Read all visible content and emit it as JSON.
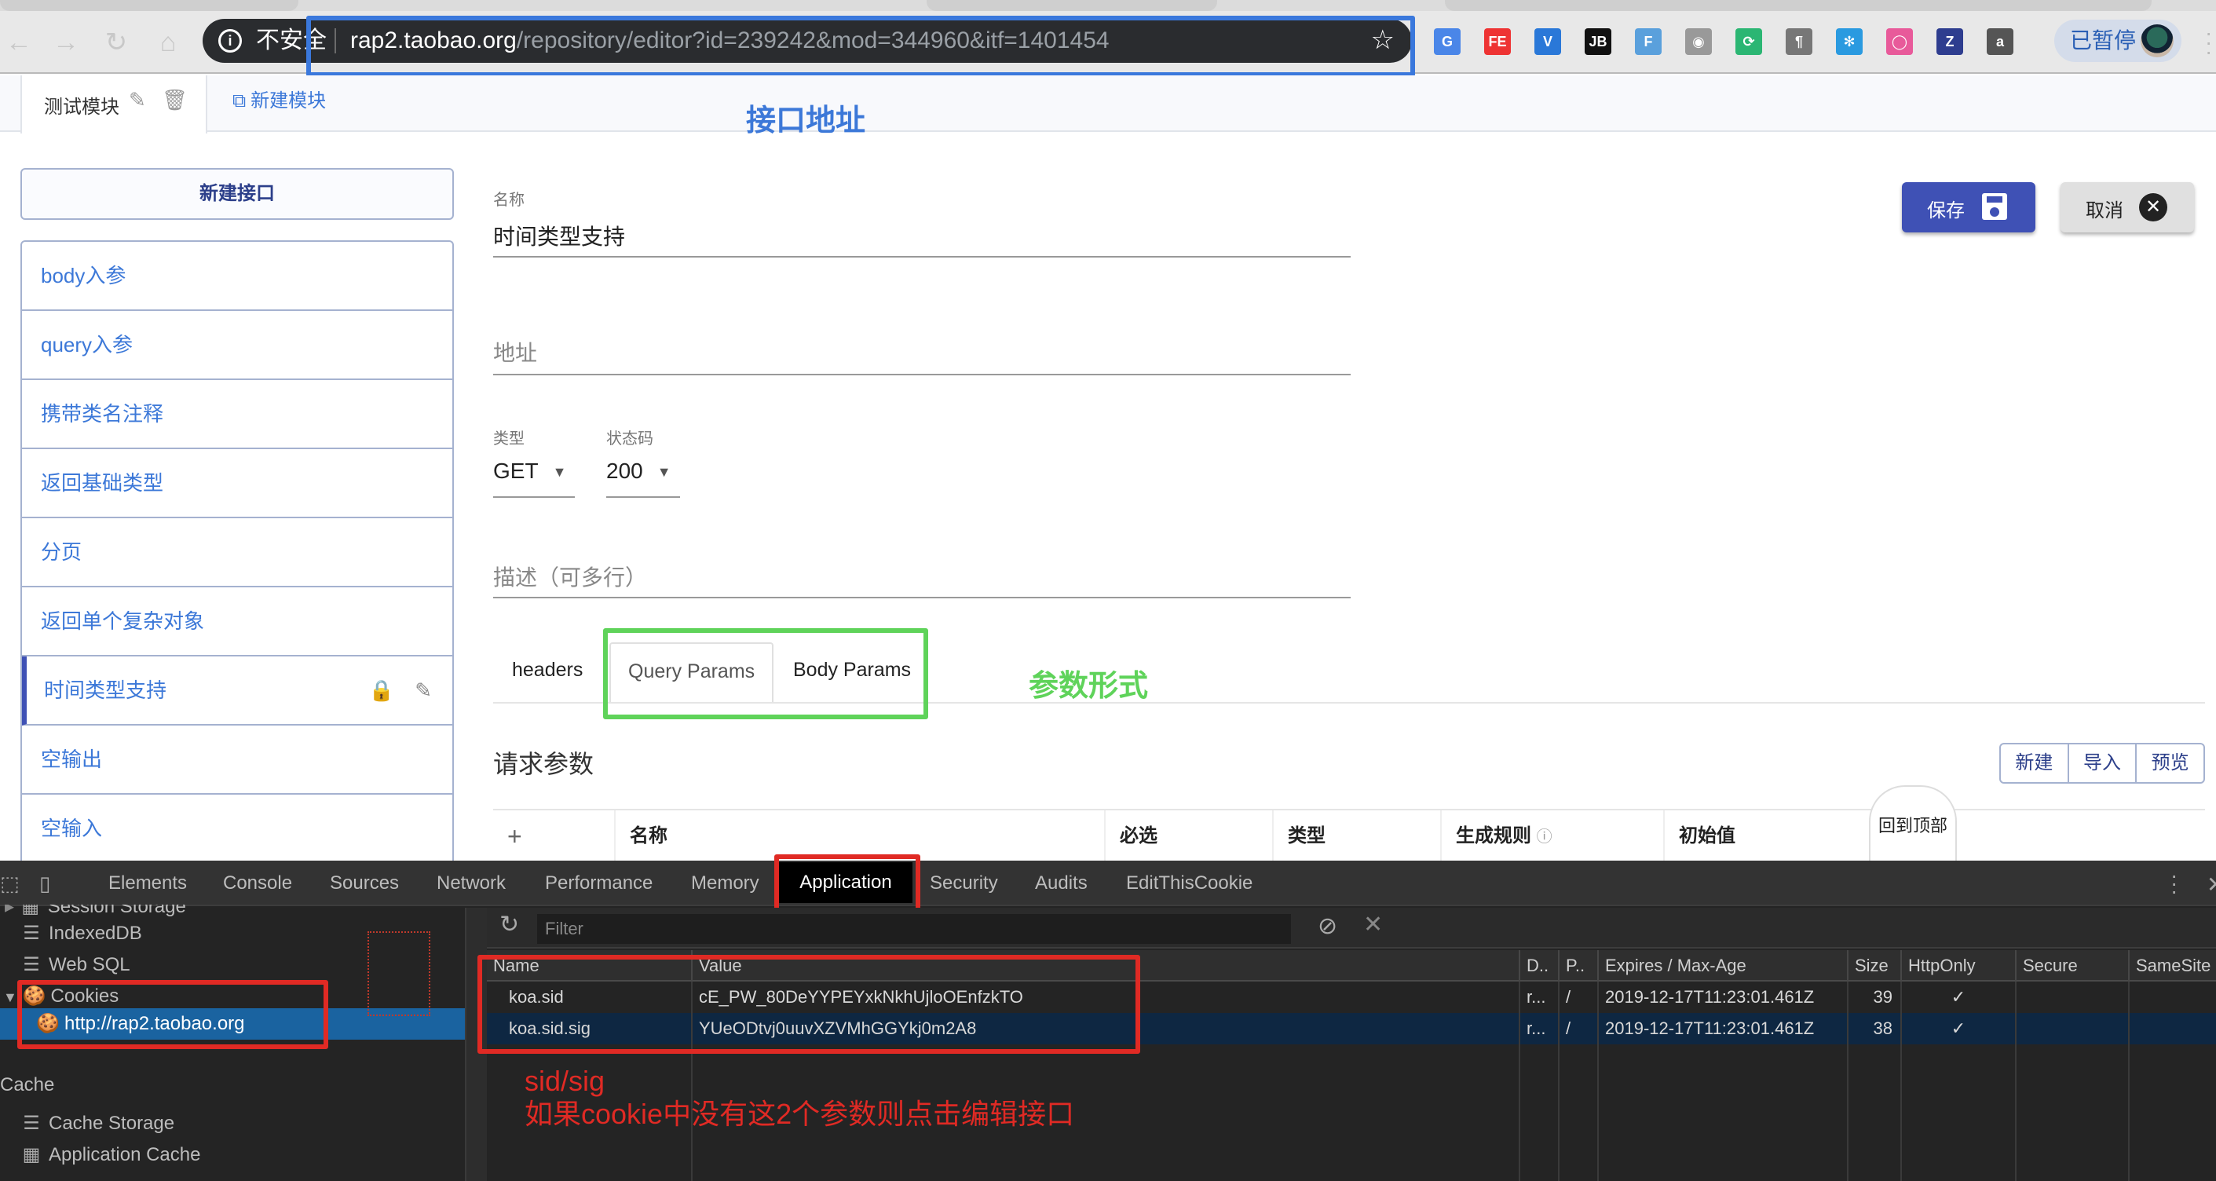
{
  "browser": {
    "security_label": "不安全",
    "url_host": "rap2.taobao.org",
    "url_path": "/repository/editor?id=239242&mod=344960&itf=1401454",
    "profile_status": "已暂停",
    "extensions": [
      {
        "name": "google-translate",
        "glyph": "G",
        "color": "#4a86e8"
      },
      {
        "name": "fe-helper",
        "glyph": "FE",
        "color": "#e33"
      },
      {
        "name": "vue-devtools",
        "glyph": "V",
        "color": "#2a78d8"
      },
      {
        "name": "jetbrains",
        "glyph": "JB",
        "color": "#111"
      },
      {
        "name": "fi",
        "glyph": "F",
        "color": "#5aa0dc"
      },
      {
        "name": "screenshot",
        "glyph": "◉",
        "color": "#999"
      },
      {
        "name": "sync",
        "glyph": "⟳",
        "color": "#2bb673"
      },
      {
        "name": "paragraph",
        "glyph": "¶",
        "color": "#777"
      },
      {
        "name": "pinwheel",
        "glyph": "✻",
        "color": "#2a9ae0"
      },
      {
        "name": "color-ring",
        "glyph": "◯",
        "color": "#e85a9a"
      },
      {
        "name": "z-ext",
        "glyph": "Z",
        "color": "#2e3d8f"
      },
      {
        "name": "a-ext",
        "glyph": "a",
        "color": "#555"
      }
    ]
  },
  "annotations": {
    "api_address": "接口地址",
    "param_form": "参数形式",
    "sid_sig": "sid/sig",
    "tip": "如果cookie中没有这2个参数则点击编辑接口"
  },
  "modules": {
    "active_tab": "测试模块",
    "new_module": "新建模块"
  },
  "sidebar": {
    "new_api": "新建接口",
    "items": [
      {
        "label": "body入参"
      },
      {
        "label": "query入参"
      },
      {
        "label": "携带类名注释"
      },
      {
        "label": "返回基础类型"
      },
      {
        "label": "分页"
      },
      {
        "label": "返回单个复杂对象"
      },
      {
        "label": "时间类型支持",
        "active": true
      },
      {
        "label": "空输出"
      },
      {
        "label": "空输入"
      }
    ]
  },
  "form": {
    "name_label": "名称",
    "name_value": "时间类型支持",
    "address_placeholder": "地址",
    "type_label": "类型",
    "type_value": "GET",
    "status_label": "状态码",
    "status_value": "200",
    "description_placeholder": "描述（可多行）",
    "save": "保存",
    "cancel": "取消"
  },
  "param_tabs": {
    "headers": "headers",
    "query": "Query Params",
    "body": "Body Params"
  },
  "request_params": {
    "title": "请求参数",
    "actions": [
      "新建",
      "导入",
      "预览"
    ],
    "columns": [
      "+",
      "名称",
      "必选",
      "类型",
      "生成规则",
      "初始值"
    ],
    "back_to_top": "回到顶部"
  },
  "devtools": {
    "tabs": [
      "Elements",
      "Console",
      "Sources",
      "Network",
      "Performance",
      "Memory",
      "Application",
      "Security",
      "Audits",
      "EditThisCookie"
    ],
    "active_tab": "Application",
    "sidebar": {
      "session_storage": "Session Storage",
      "indexeddb": "IndexedDB",
      "websql": "Web SQL",
      "cookies": "Cookies",
      "cookie_host": "http://rap2.taobao.org",
      "cache_heading": "Cache",
      "cache_storage": "Cache Storage",
      "application_cache": "Application Cache"
    },
    "filter_placeholder": "Filter",
    "cookie_columns": [
      "Name",
      "Value",
      "D..",
      "P..",
      "Expires / Max-Age",
      "Size",
      "HttpOnly",
      "Secure",
      "SameSite"
    ],
    "cookies": [
      {
        "name": "koa.sid",
        "value": "cE_PW_80DeYYPEYxkNkhUjloOEnfzkTO",
        "domain": "r...",
        "path": "/",
        "expires": "2019-12-17T11:23:01.461Z",
        "size": "39",
        "httponly": "✓",
        "secure": "",
        "samesite": ""
      },
      {
        "name": "koa.sid.sig",
        "value": "YUeODtvj0uuvXZVMhGGYkj0m2A8",
        "domain": "r...",
        "path": "/",
        "expires": "2019-12-17T11:23:01.461Z",
        "size": "38",
        "httponly": "✓",
        "secure": "",
        "samesite": ""
      }
    ]
  }
}
